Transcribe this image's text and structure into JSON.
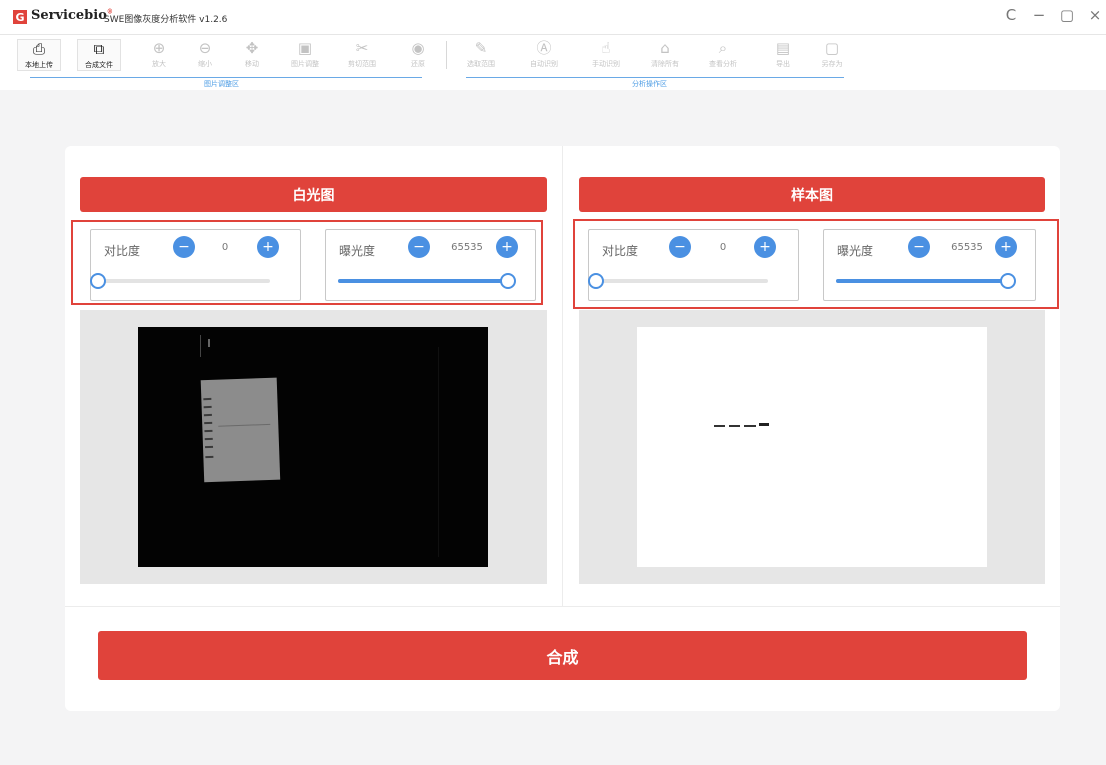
{
  "titlebar": {
    "logo_letter": "G",
    "brand": "Servicebio",
    "brand_mark": "®",
    "app_title": "SWE图像灰度分析软件 v1.2.6",
    "refresh_glyph": "C",
    "minimize_glyph": "−",
    "maximize_glyph": "▢",
    "close_glyph": "×"
  },
  "toolbar": {
    "tools": [
      {
        "label": "本地上传",
        "icon": "upload-icon",
        "glyph": "⎙"
      },
      {
        "label": "合成文件",
        "icon": "composite-icon",
        "glyph": "⧉"
      },
      {
        "label": "放大",
        "icon": "zoom-in-icon",
        "glyph": "⊕"
      },
      {
        "label": "缩小",
        "icon": "zoom-out-icon",
        "glyph": "⊖"
      },
      {
        "label": "移动",
        "icon": "move-icon",
        "glyph": "✥"
      },
      {
        "label": "图片调整",
        "icon": "image-adjust-icon",
        "glyph": "▣"
      },
      {
        "label": "剪切范围",
        "icon": "scissors-icon",
        "glyph": "✂"
      },
      {
        "label": "还原",
        "icon": "restore-icon",
        "glyph": "◉"
      },
      {
        "label": "选取范围",
        "icon": "select-range-icon",
        "glyph": "✎"
      },
      {
        "label": "自动识别",
        "icon": "auto-detect-icon",
        "glyph": "Ⓐ"
      },
      {
        "label": "手动识别",
        "icon": "manual-detect-icon",
        "glyph": "☝"
      },
      {
        "label": "清除所有",
        "icon": "clear-all-icon",
        "glyph": "⌂"
      },
      {
        "label": "查看分析",
        "icon": "view-analysis-icon",
        "glyph": "⌕"
      },
      {
        "label": "导出",
        "icon": "export-icon",
        "glyph": "▤"
      },
      {
        "label": "另存为",
        "icon": "save-as-icon",
        "glyph": "▢"
      }
    ],
    "group_image": "图片调整区",
    "group_analysis": "分析操作区"
  },
  "panels": {
    "left": {
      "header": "白光图",
      "contrast": {
        "label": "对比度",
        "value": "0",
        "minus": "−",
        "plus": "+",
        "level": 0.0
      },
      "exposure": {
        "label": "曝光度",
        "value": "65535",
        "minus": "−",
        "plus": "+",
        "level": 1.0
      }
    },
    "right": {
      "header": "样本图",
      "contrast": {
        "label": "对比度",
        "value": "0",
        "minus": "−",
        "plus": "+",
        "level": 0.0
      },
      "exposure": {
        "label": "曝光度",
        "value": "65535",
        "minus": "−",
        "plus": "+",
        "level": 1.0
      }
    }
  },
  "merge_button": "合成",
  "colors": {
    "accent_red": "#e0433b",
    "accent_blue": "#4a90e2"
  }
}
